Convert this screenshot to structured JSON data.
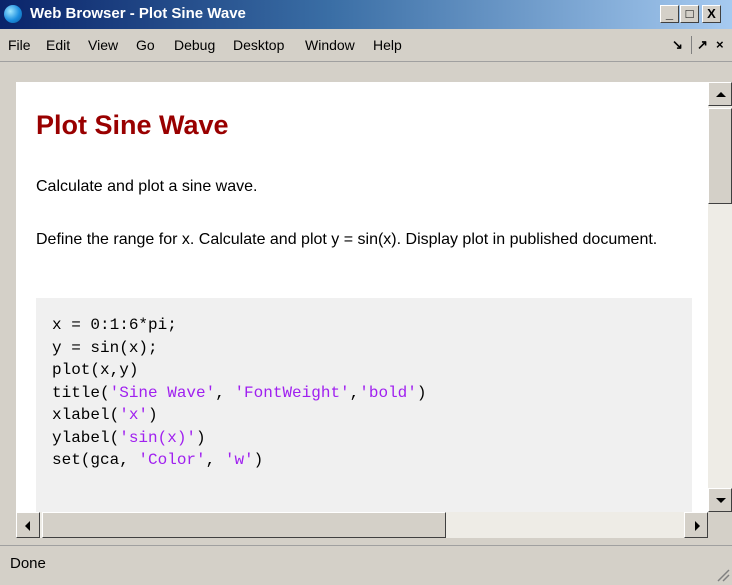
{
  "window": {
    "title": "Web Browser - Plot Sine Wave",
    "minimize": "_",
    "restore": "□",
    "close": "X"
  },
  "menubar": {
    "items": [
      "File",
      "Edit",
      "View",
      "Go",
      "Debug",
      "Desktop",
      "Window",
      "Help"
    ],
    "controls": {
      "dock": "↘",
      "undock": "↗",
      "close": "×"
    }
  },
  "document": {
    "heading": "Plot Sine Wave",
    "summary": "Calculate and plot a sine wave.",
    "description": "Define the range for x. Calculate and plot y = sin(x). Display plot in published document.",
    "code_lines": [
      [
        {
          "t": "x = 0:1:6*pi;",
          "s": false
        }
      ],
      [
        {
          "t": "y = sin(x);",
          "s": false
        }
      ],
      [
        {
          "t": "plot(x,y)",
          "s": false
        }
      ],
      [
        {
          "t": "title(",
          "s": false
        },
        {
          "t": "'Sine Wave'",
          "s": true
        },
        {
          "t": ", ",
          "s": false
        },
        {
          "t": "'FontWeight'",
          "s": true
        },
        {
          "t": ",",
          "s": false
        },
        {
          "t": "'bold'",
          "s": true
        },
        {
          "t": ")",
          "s": false
        }
      ],
      [
        {
          "t": "xlabel(",
          "s": false
        },
        {
          "t": "'x'",
          "s": true
        },
        {
          "t": ")",
          "s": false
        }
      ],
      [
        {
          "t": "ylabel(",
          "s": false
        },
        {
          "t": "'sin(x)'",
          "s": true
        },
        {
          "t": ")",
          "s": false
        }
      ],
      [
        {
          "t": "set(gca, ",
          "s": false
        },
        {
          "t": "'Color'",
          "s": true
        },
        {
          "t": ", ",
          "s": false
        },
        {
          "t": "'w'",
          "s": true
        },
        {
          "t": ")",
          "s": false
        }
      ]
    ]
  },
  "status": {
    "text": "Done"
  },
  "colors": {
    "heading": "#990000",
    "string_literal": "#a020f0",
    "code_bg": "#f0f0f0"
  }
}
